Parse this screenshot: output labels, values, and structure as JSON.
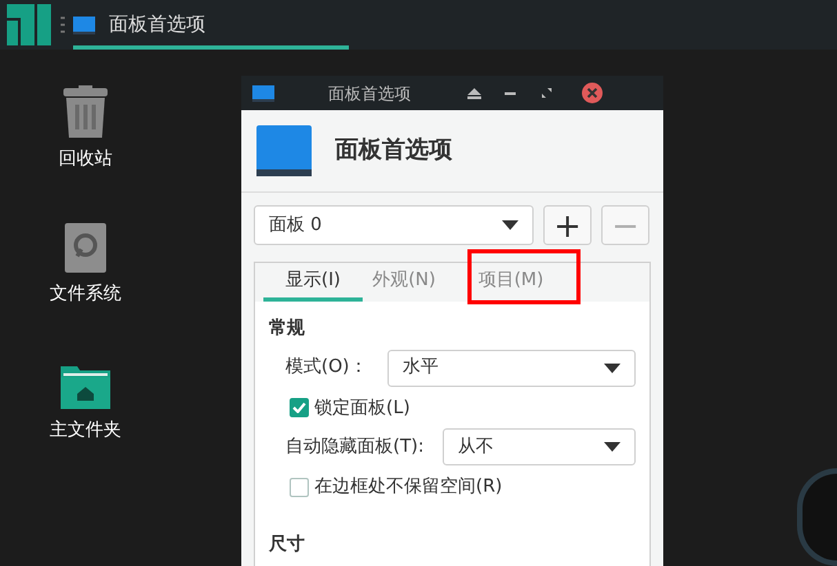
{
  "taskbar": {
    "task": {
      "title": "面板首选项",
      "selected": true
    }
  },
  "desktop_icons": [
    {
      "kind": "trash",
      "label": "回收站"
    },
    {
      "kind": "drive",
      "label": "文件系统"
    },
    {
      "kind": "home",
      "label": "主文件夹"
    }
  ],
  "window": {
    "title": "面板首选项",
    "heading": "面板首选项",
    "panel_select": {
      "value": "面板 0"
    },
    "add_button": {
      "label": "+",
      "disabled": false
    },
    "remove_button": {
      "label": "−",
      "disabled": true
    },
    "tabs": [
      {
        "label": "显示(I)",
        "selected": true,
        "highlighted": false
      },
      {
        "label": "外观(N)",
        "selected": false,
        "highlighted": false
      },
      {
        "label": "项目(M)",
        "selected": false,
        "highlighted": true
      }
    ],
    "section": "常规",
    "rows": [
      {
        "kind": "select",
        "label": "模式(O)：",
        "value": "水平"
      },
      {
        "kind": "checkbox",
        "label": "锁定面板(L)",
        "checked": true
      },
      {
        "kind": "select",
        "label": "自动隐藏面板(T):",
        "value": "从不"
      },
      {
        "kind": "checkbox",
        "label": "在边框处不保留空间(R)",
        "checked": false
      }
    ],
    "next_section": "尺寸"
  }
}
